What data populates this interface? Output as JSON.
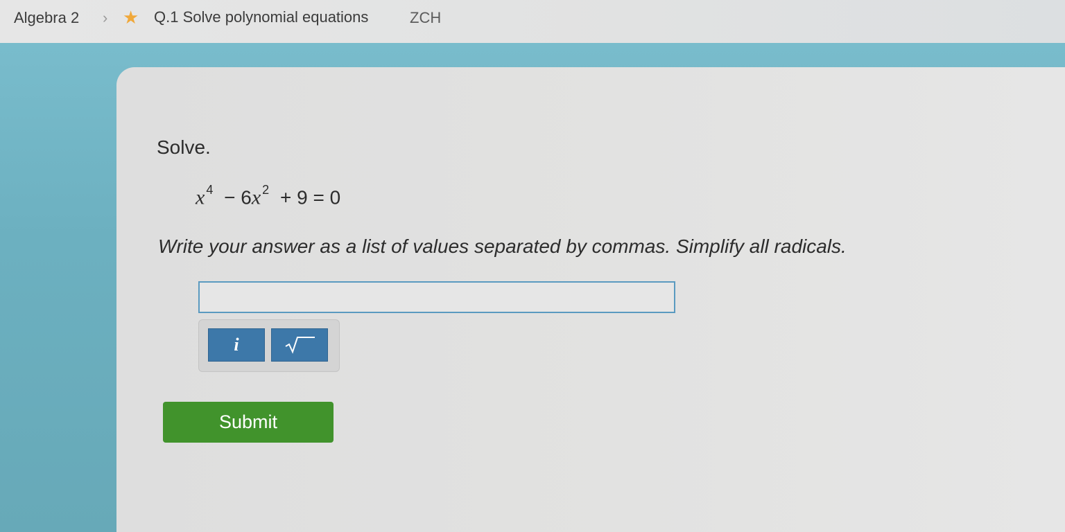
{
  "breadcrumb": {
    "subject": "Algebra 2",
    "skill": "Q.1 Solve polynomial equations",
    "code": "ZCH"
  },
  "question": {
    "prompt": "Solve.",
    "equation": {
      "var1": "x",
      "exp1": "4",
      "op1": "−",
      "coef2": "6",
      "var2": "x",
      "exp2": "2",
      "op2": "+",
      "const": "9",
      "eq": "=",
      "rhs": "0"
    },
    "instruction": "Write your answer as a list of values separated by commas. Simplify all radicals."
  },
  "answer": {
    "value": ""
  },
  "keypad": {
    "imaginary_label": "i"
  },
  "submit_label": "Submit",
  "colors": {
    "accent": "#3d78a9",
    "submit": "#41932c",
    "band": "#6fb2c3",
    "star": "#f0a83a"
  },
  "icons": [
    "chevron-right-icon",
    "star-icon",
    "square-root-icon"
  ]
}
